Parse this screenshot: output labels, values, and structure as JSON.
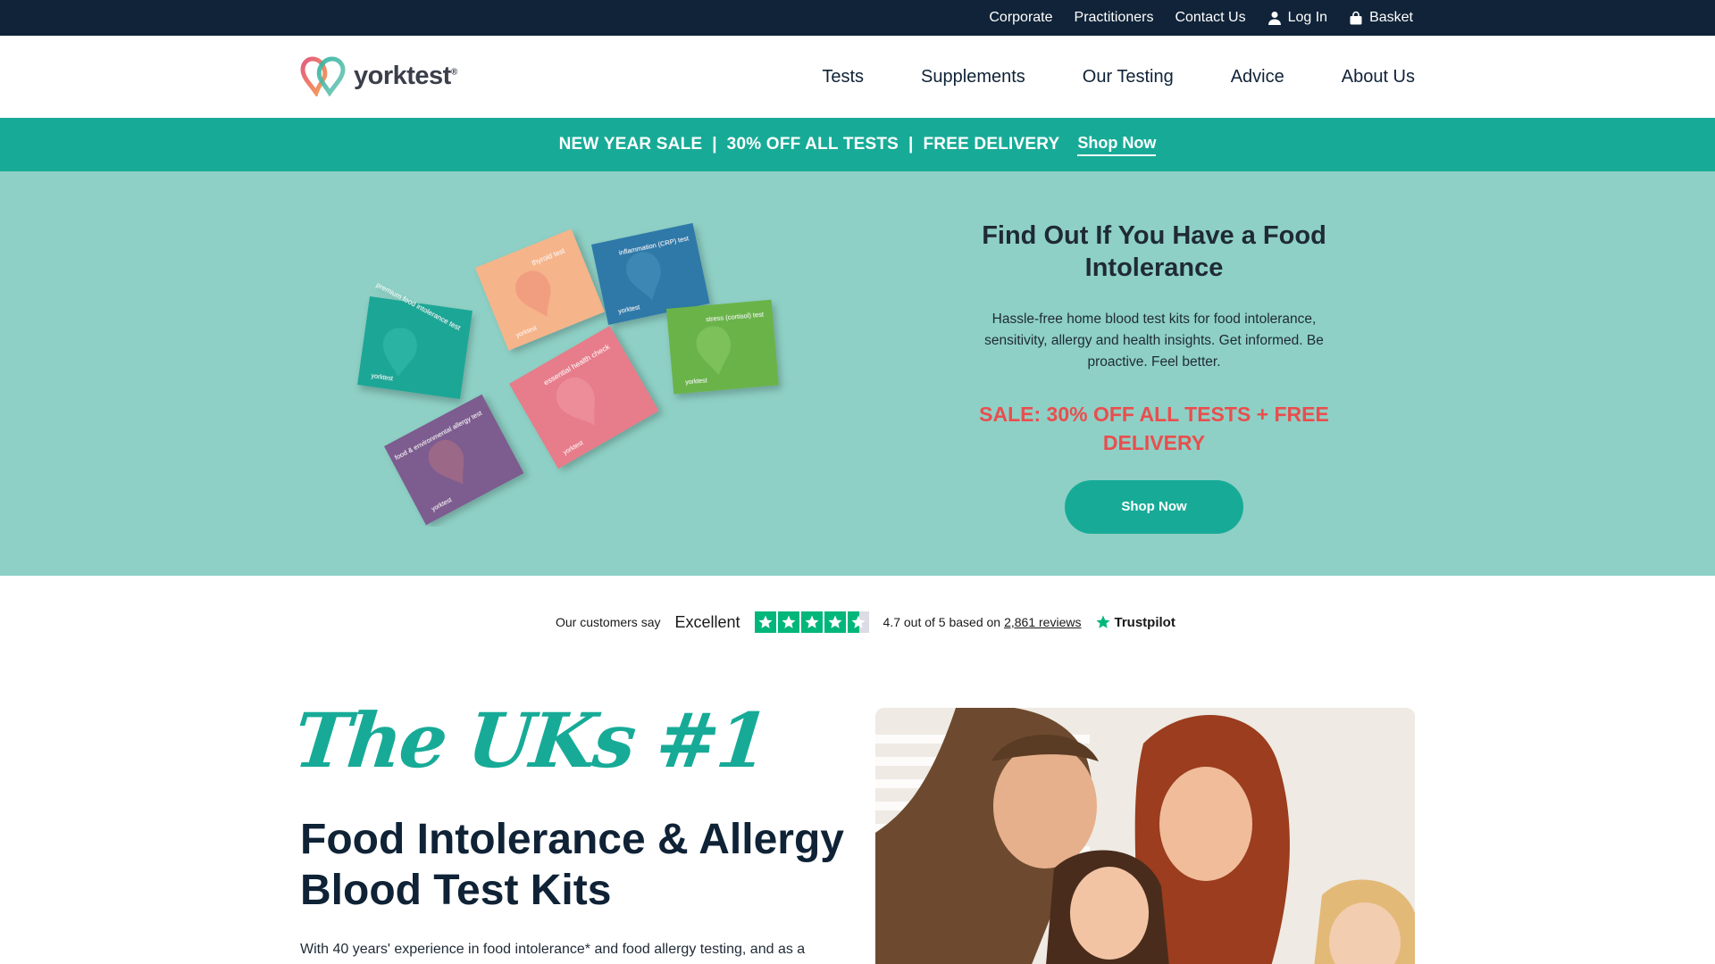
{
  "utility_nav": {
    "corporate": "Corporate",
    "practitioners": "Practitioners",
    "contact": "Contact Us",
    "login": "Log In",
    "basket": "Basket"
  },
  "header": {
    "logo_text": "yorktest",
    "logo_mark": "®",
    "nav": [
      "Tests",
      "Supplements",
      "Our Testing",
      "Advice",
      "About Us"
    ]
  },
  "promo": {
    "text": "NEW YEAR SALE  |  30% OFF ALL TESTS  |  FREE DELIVERY",
    "link": "Shop Now"
  },
  "hero": {
    "title": "Find Out If You Have a Food Intolerance",
    "subtitle": "Hassle-free home blood test kits for food intolerance, sensitivity, allergy and health insights. Get informed. Be proactive. Feel better.",
    "sale": "SALE: 30% OFF ALL TESTS + FREE DELIVERY",
    "cta": "Shop Now",
    "boxes": [
      {
        "label": "premium food intolerance test",
        "color": "#1fa696"
      },
      {
        "label": "thyroid test",
        "color": "#f5b48a"
      },
      {
        "label": "inflammation (CRP) test",
        "color": "#2f79a8"
      },
      {
        "label": "stress (cortisol) test",
        "color": "#6bb34a"
      },
      {
        "label": "essential health check",
        "color": "#e77c8a"
      },
      {
        "label": "food & environmental allergy test",
        "color": "#7d5b8f"
      }
    ],
    "box_brand": "yorktest"
  },
  "trustpilot": {
    "lead": "Our customers say",
    "rating_word": "Excellent",
    "score_text": "4.7 out of 5 based on",
    "review_count": "2,861 reviews",
    "brand": "Trustpilot",
    "stars": 4.5
  },
  "intro": {
    "tagline": "The UKs #1",
    "title": "Food Intolerance & Allergy Blood Test Kits",
    "body": "With 40 years' experience in food intolerance* and food allergy testing, and as a"
  },
  "colors": {
    "dark_navy": "#102338",
    "teal": "#17ab97",
    "hero_bg": "#8ed0c5",
    "sale_red": "#e94e4e",
    "trustpilot_green": "#00b67a"
  },
  "icons": {
    "login": "user-icon",
    "basket": "shopping-bag-icon",
    "logo": "heart-logo-icon",
    "trustpilot": "star-icon"
  }
}
